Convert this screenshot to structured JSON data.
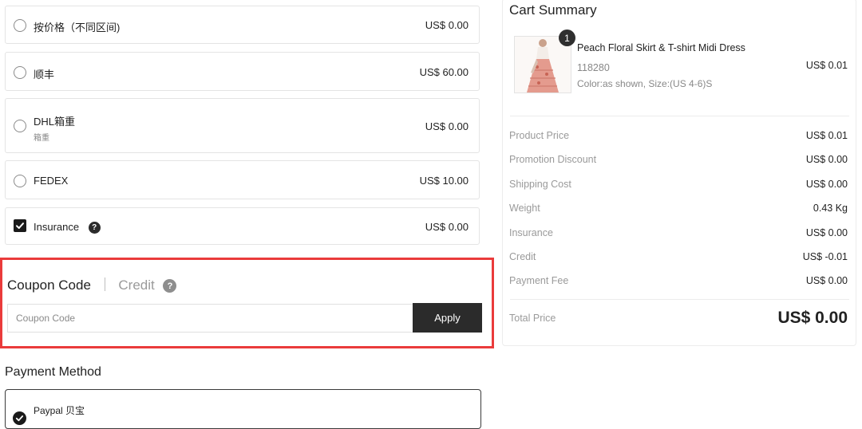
{
  "shipping": {
    "options": [
      {
        "label": "按价格（不同区间)",
        "price": "US$ 0.00"
      },
      {
        "label": "顺丰",
        "price": "US$ 60.00"
      },
      {
        "label": "DHL箱重",
        "sublabel": "箱重",
        "price": "US$ 0.00"
      },
      {
        "label": "FEDEX",
        "price": "US$ 10.00"
      }
    ],
    "insurance": {
      "label": "Insurance",
      "price": "US$ 0.00",
      "checked": true
    }
  },
  "coupon": {
    "tab_active": "Coupon Code",
    "tab_inactive": "Credit",
    "input_placeholder": "Coupon Code",
    "apply_label": "Apply"
  },
  "payment": {
    "title": "Payment Method",
    "selected_option": "Paypal 贝宝"
  },
  "cart": {
    "title": "Cart Summary",
    "item": {
      "quantity": "1",
      "name": "Peach Floral Skirt & T-shirt Midi Dress",
      "sku": "118280",
      "attributes": "Color:as shown, Size:(US 4-6)S",
      "price": "US$ 0.01"
    },
    "summary": [
      {
        "label": "Product Price",
        "value": "US$ 0.01"
      },
      {
        "label": "Promotion Discount",
        "value": "US$ 0.00"
      },
      {
        "label": "Shipping Cost",
        "value": "US$ 0.00"
      },
      {
        "label": "Weight",
        "value": "0.43 Kg"
      },
      {
        "label": "Insurance",
        "value": "US$ 0.00"
      },
      {
        "label": "Credit",
        "value": "US$ -0.01"
      },
      {
        "label": "Payment Fee",
        "value": "US$ 0.00"
      }
    ],
    "total_label": "Total Price",
    "total_value": "US$ 0.00"
  },
  "icons": {
    "help": "question-circle-icon",
    "check": "check-icon"
  },
  "colors": {
    "highlight_border": "#ea3b3b",
    "apply_button": "#2b2b2b"
  }
}
